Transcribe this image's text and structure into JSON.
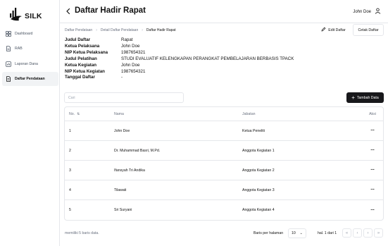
{
  "app": {
    "logo_text": "SILK"
  },
  "sidebar": {
    "items": [
      {
        "label": "Dashboard",
        "icon": "dashboard-icon"
      },
      {
        "label": "RAB",
        "icon": "document-icon"
      },
      {
        "label": "Laporan Dana",
        "icon": "report-icon"
      },
      {
        "label": "Daftar Pendataan",
        "icon": "list-icon",
        "active": true
      }
    ]
  },
  "header": {
    "title": "Daftar Hadir Rapat",
    "user_name": "John Doe"
  },
  "breadcrumb": [
    "Daftar Pendataan",
    "Detail Daftar Pendataan",
    "Daftar Hadir Rapat"
  ],
  "actions": {
    "edit_label": "Edit Daftar",
    "print_label": "Cetak Daftar"
  },
  "info": [
    {
      "key": "Judul Daftar",
      "value": "Rapat"
    },
    {
      "key": "Ketua Pelaksana",
      "value": "John Doe"
    },
    {
      "key": "NIP Ketua Pelaksana",
      "value": "1987654321"
    },
    {
      "key": "Judul Pelatihan",
      "value": "STUDI EVALUATIF KELENGKAPAN PERANGKAT PEMBELAJARAN BERBASIS TPACK"
    },
    {
      "key": "Ketua Kegiatan",
      "value": "John Doe"
    },
    {
      "key": "NIP Ketua Kegiatan",
      "value": "1987654321"
    },
    {
      "key": "Tanggal Daftar",
      "value": "-"
    }
  ],
  "search": {
    "placeholder": "Cari",
    "value": ""
  },
  "add_button": {
    "label": "Tambah Data"
  },
  "table": {
    "headers": {
      "no": "No.",
      "sort": "⇅",
      "nama": "Nama",
      "jabatan": "Jabatan",
      "aksi": "Aksi"
    },
    "rows": [
      {
        "no": "1",
        "nama": "John Doe",
        "jabatan": "Ketua Peneliti"
      },
      {
        "no": "2",
        "nama": "Dr. Muhammad Basri, M.Pd.",
        "jabatan": "Anggota Kegiatan 1"
      },
      {
        "no": "3",
        "nama": "Ifansyah Tri Andika",
        "jabatan": "Anggota Kegiatan 2"
      },
      {
        "no": "4",
        "nama": "Tilawati",
        "jabatan": "Anggota Kegiatan 3"
      },
      {
        "no": "5",
        "nama": "Sri Suryani",
        "jabatan": "Anggota Kegiatan 4"
      }
    ],
    "row_action": "···"
  },
  "footer": {
    "count_text": "memiliki 5 baris data.",
    "rows_per_page_label": "Baris per halaman",
    "rows_per_page_value": "10",
    "page_text": "hal. 1 dari 1"
  },
  "colors": {
    "primary_button": "#18181b",
    "active_nav_bg": "#f1f3f5",
    "border": "#e5e7eb"
  }
}
